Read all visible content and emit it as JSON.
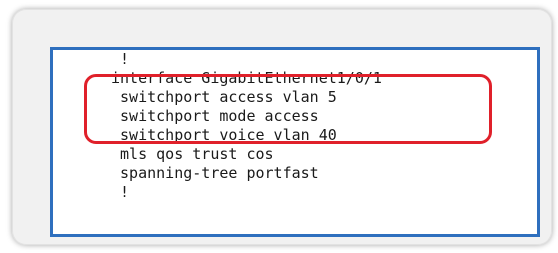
{
  "config": {
    "lines": [
      " !",
      "interface GigabitEthernet1/0/1",
      " switchport access vlan 5",
      " switchport mode access",
      " switchport voice vlan 40",
      " mls qos trust cos",
      " spanning-tree portfast",
      " !"
    ]
  },
  "colors": {
    "box_border": "#2e6fbe",
    "highlight_border": "#e0202a",
    "text": "#1a1a1a"
  }
}
